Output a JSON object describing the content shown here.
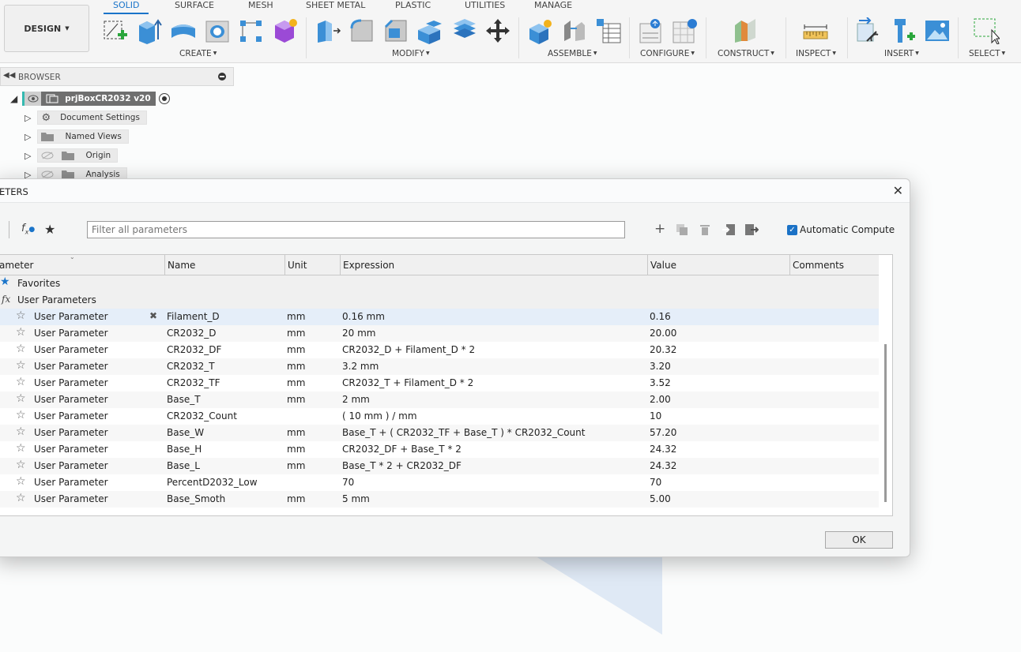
{
  "ribbon": {
    "workspace": "DESIGN",
    "tabs": [
      "SOLID",
      "SURFACE",
      "MESH",
      "SHEET METAL",
      "PLASTIC",
      "UTILITIES",
      "MANAGE"
    ],
    "groups": [
      "CREATE",
      "MODIFY",
      "ASSEMBLE",
      "CONFIGURE",
      "CONSTRUCT",
      "INSPECT",
      "INSERT",
      "SELECT"
    ]
  },
  "browser": {
    "title": "BROWSER",
    "root": "prjBoxCR2032 v20",
    "items": [
      "Document Settings",
      "Named Views",
      "Origin",
      "Analysis"
    ]
  },
  "dialog": {
    "title": "ETERS",
    "filter_placeholder": "Filter all parameters",
    "auto_compute": "Automatic Compute",
    "ok": "OK",
    "columns": [
      "ameter",
      "Name",
      "Unit",
      "Expression",
      "Value",
      "Comments"
    ],
    "groups": {
      "favorites": "Favorites",
      "user": "User Parameters"
    },
    "rows": [
      {
        "type": "User Parameter",
        "name": "Filament_D",
        "unit": "mm",
        "expr": "0.16 mm",
        "value": "0.16"
      },
      {
        "type": "User Parameter",
        "name": "CR2032_D",
        "unit": "mm",
        "expr": "20 mm",
        "value": "20.00"
      },
      {
        "type": "User Parameter",
        "name": "CR2032_DF",
        "unit": "mm",
        "expr": "CR2032_D + Filament_D * 2",
        "value": "20.32"
      },
      {
        "type": "User Parameter",
        "name": "CR2032_T",
        "unit": "mm",
        "expr": "3.2 mm",
        "value": "3.20"
      },
      {
        "type": "User Parameter",
        "name": "CR2032_TF",
        "unit": "mm",
        "expr": "CR2032_T + Filament_D * 2",
        "value": "3.52"
      },
      {
        "type": "User Parameter",
        "name": "Base_T",
        "unit": "mm",
        "expr": "2 mm",
        "value": "2.00"
      },
      {
        "type": "User Parameter",
        "name": "CR2032_Count",
        "unit": "",
        "expr": "( 10 mm ) / mm",
        "value": "10"
      },
      {
        "type": "User Parameter",
        "name": "Base_W",
        "unit": "mm",
        "expr": "Base_T + ( CR2032_TF + Base_T ) * CR2032_Count",
        "value": "57.20"
      },
      {
        "type": "User Parameter",
        "name": "Base_H",
        "unit": "mm",
        "expr": "CR2032_DF + Base_T * 2",
        "value": "24.32"
      },
      {
        "type": "User Parameter",
        "name": "Base_L",
        "unit": "mm",
        "expr": "Base_T * 2 + CR2032_DF",
        "value": "24.32"
      },
      {
        "type": "User Parameter",
        "name": "PercentD2032_Low",
        "unit": "",
        "expr": "70",
        "value": "70"
      },
      {
        "type": "User Parameter",
        "name": "Base_Smoth",
        "unit": "mm",
        "expr": "5 mm",
        "value": "5.00"
      }
    ]
  }
}
